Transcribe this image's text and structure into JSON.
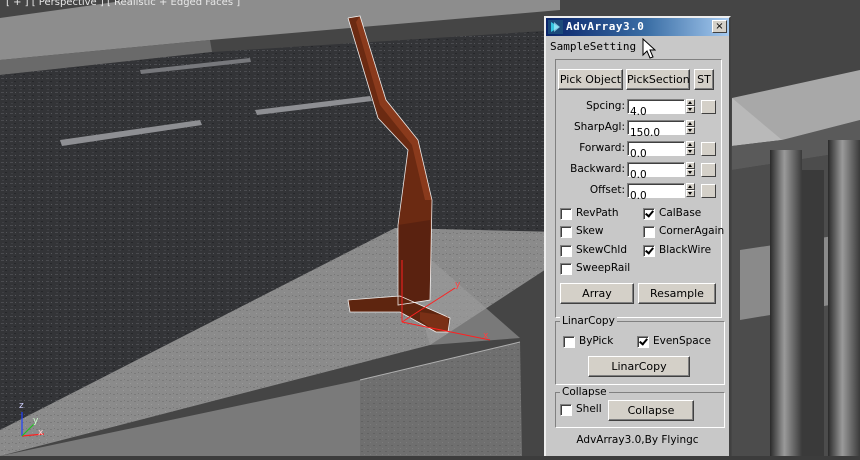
{
  "viewport": {
    "label": "[ + ] [ Perspective ] [ Realistic + Edged Faces ]",
    "axis": {
      "x": "x",
      "y": "y",
      "z": "z"
    }
  },
  "window": {
    "title": "AdvArray3.0",
    "close_glyph": "×",
    "menu": "SampleSetting",
    "buttons": {
      "pick_object": "Pick Object",
      "pick_section": "PickSection",
      "st": "ST"
    },
    "params": [
      {
        "label": "Spcing:",
        "value": "4.0"
      },
      {
        "label": "SharpAgl:",
        "value": "150.0"
      },
      {
        "label": "Forward:",
        "value": "0.0"
      },
      {
        "label": "Backward:",
        "value": "0.0"
      },
      {
        "label": "Offset:",
        "value": "0.0"
      }
    ],
    "checks": {
      "revpath": {
        "label": "RevPath",
        "checked": false
      },
      "calbase": {
        "label": "CalBase",
        "checked": true
      },
      "skew": {
        "label": "Skew",
        "checked": false
      },
      "corneragain": {
        "label": "CornerAgain",
        "checked": false
      },
      "skewchld": {
        "label": "SkewChld",
        "checked": false
      },
      "blackwire": {
        "label": "BlackWire",
        "checked": true
      },
      "sweeprail": {
        "label": "SweepRail",
        "checked": false
      }
    },
    "actions": {
      "array": "Array",
      "resample": "Resample"
    },
    "linarcopy": {
      "title": "LinarCopy",
      "bypick": {
        "label": "ByPick",
        "checked": false
      },
      "evenspace": {
        "label": "EvenSpace",
        "checked": true
      },
      "button": "LinarCopy"
    },
    "collapse": {
      "title": "Collapse",
      "shell": {
        "label": "Shell",
        "checked": false
      },
      "button": "Collapse"
    },
    "credit": "AdvArray3.0,By Flyingc"
  },
  "colors": {
    "title_start": "#0a246a",
    "title_end": "#a6caf0",
    "panel": "#c8c8c8",
    "object": "#6b2a12",
    "selection": "#ff2020"
  }
}
